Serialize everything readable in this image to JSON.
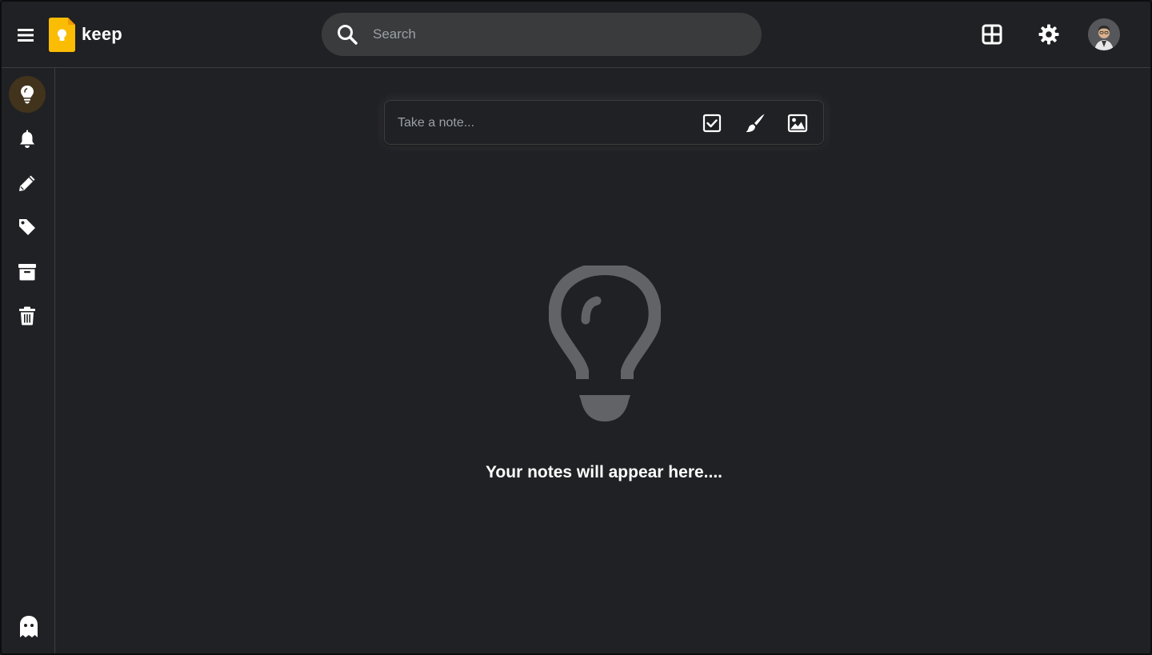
{
  "app": {
    "brand": "keep",
    "accent_color": "#fbbc04",
    "logo_icon": "keep-logo-icon"
  },
  "header": {
    "menu_icon": "hamburger-menu-icon",
    "search": {
      "placeholder": "Search",
      "value": "",
      "icon": "search-icon"
    },
    "actions": [
      {
        "name": "grid-view-icon"
      },
      {
        "name": "settings-gear-icon"
      },
      {
        "name": "user-avatar"
      }
    ]
  },
  "sidebar": {
    "items": [
      {
        "name": "notes",
        "icon": "lightbulb-icon",
        "active": true
      },
      {
        "name": "reminders",
        "icon": "bell-icon",
        "active": false
      },
      {
        "name": "edit-labels",
        "icon": "pencil-icon",
        "active": false
      },
      {
        "name": "labels",
        "icon": "tag-icon",
        "active": false
      },
      {
        "name": "archive",
        "icon": "archive-icon",
        "active": false
      },
      {
        "name": "trash",
        "icon": "trash-icon",
        "active": false
      }
    ],
    "footer_icon": "ghost-icon"
  },
  "composer": {
    "placeholder": "Take a note...",
    "value": "",
    "actions": [
      "checkbox-list-icon",
      "brush-icon",
      "image-icon"
    ]
  },
  "empty_state": {
    "icon": "lightbulb-outline-icon",
    "message": "Your notes will appear here...."
  }
}
